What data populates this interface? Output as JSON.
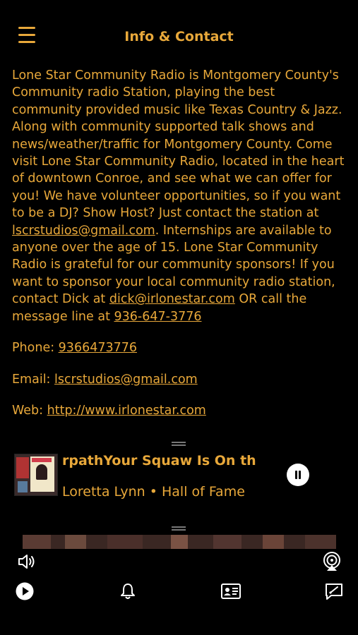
{
  "header": {
    "title": "Info & Contact",
    "menu_icon": "hamburger-menu-icon"
  },
  "content": {
    "intro_part1": "Lone Star Community Radio is Montgomery County's Community radio Station, playing the best community provided music like Texas Country & Jazz. Along with community supported talk shows and news/weather/traffic for Montgomery County. Come visit Lone Star Community Radio, located in the heart of downtown Conroe, and see what we can offer for you! We have volunteer opportunities, so if you want to be a DJ? Show Host? Just contact the station at ",
    "intro_email_link": "lscrstudios@gmail.com",
    "intro_part2": ". Internships are available to anyone over the age of 15. Lone Star Community Radio is grateful for our community sponsors! If you want to sponsor your local community radio station, contact Dick at ",
    "dick_email_link": "dick@irlonestar.com",
    "intro_part3": " OR call the message line at ",
    "message_phone_link": "936-647-3776",
    "phone_label": "Phone: ",
    "phone_value": "9366473776",
    "email_label": "Email: ",
    "email_value": "lscrstudios@gmail.com",
    "web_label": "Web: ",
    "web_value": "http://www.irlonestar.com"
  },
  "player": {
    "track_title": "rpathYour Squaw Is On th",
    "artist_album": "Loretta Lynn • Hall of Fame",
    "pause_icon": "pause-icon"
  },
  "bottom_bar": {
    "volume_icon": "volume-icon",
    "airplay_icon": "airplay-icon",
    "tabs": [
      {
        "icon": "play-tab-icon"
      },
      {
        "icon": "bell-tab-icon"
      },
      {
        "icon": "contact-card-tab-icon"
      },
      {
        "icon": "message-tab-icon"
      }
    ]
  },
  "colors": {
    "accent": "#e8a83a",
    "background": "#000000"
  }
}
